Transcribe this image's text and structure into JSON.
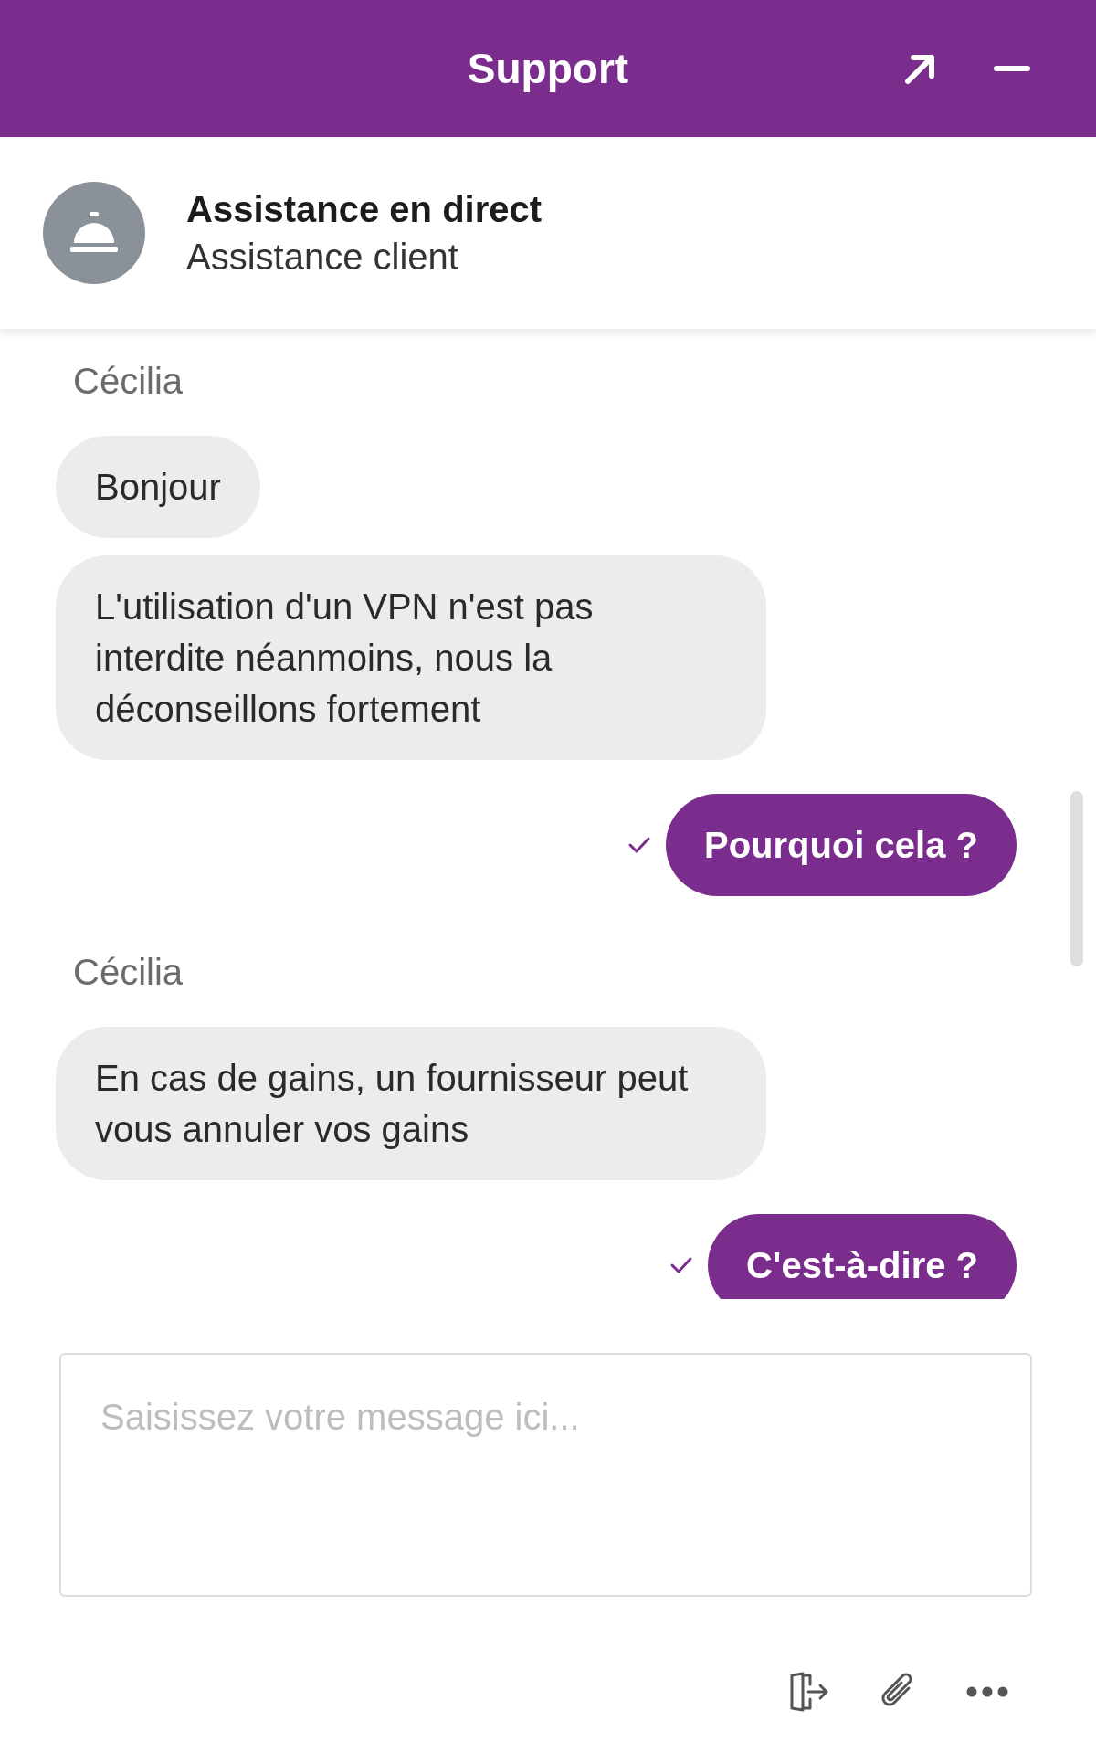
{
  "header": {
    "title": "Support"
  },
  "agent": {
    "name": "Assistance en direct",
    "role": "Assistance client"
  },
  "messages": [
    {
      "kind": "sender",
      "text": "Cécilia"
    },
    {
      "kind": "agent",
      "text": "Bonjour"
    },
    {
      "kind": "agent",
      "text": "L'utilisation d'un VPN n'est pas interdite néanmoins, nous la déconseillons fortement"
    },
    {
      "kind": "user",
      "text": "Pourquoi cela ?",
      "delivered": true
    },
    {
      "kind": "sender",
      "text": "Cécilia"
    },
    {
      "kind": "agent",
      "text": "En cas de gains, un fournisseur peut vous annuler vos gains"
    },
    {
      "kind": "user",
      "text": "C'est-à-dire ?",
      "delivered": true
    }
  ],
  "composer": {
    "placeholder": "Saisissez votre message ici..."
  }
}
